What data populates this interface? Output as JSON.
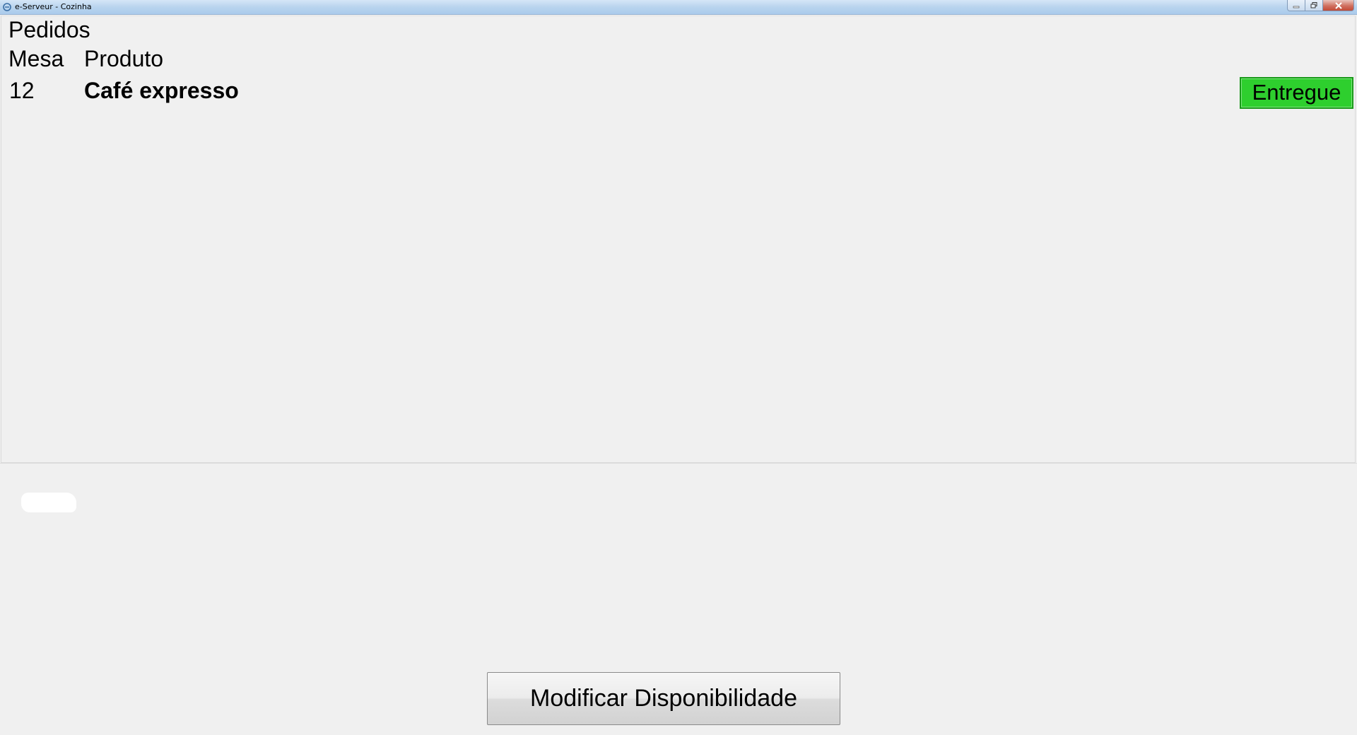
{
  "window": {
    "title": "e-Serveur - Cozinha",
    "icon": "app-e-icon",
    "controls": [
      "minimize-icon",
      "maximize-icon",
      "close-icon"
    ]
  },
  "orders": {
    "title": "Pedidos",
    "columns": {
      "mesa": "Mesa",
      "produto": "Produto"
    },
    "rows": [
      {
        "mesa": "12",
        "produto": "Café expresso",
        "action_label": "Entregue",
        "action_color": "#2ecf2e"
      }
    ]
  },
  "footer": {
    "modify_button_label": "Modificar Disponibilidade"
  }
}
